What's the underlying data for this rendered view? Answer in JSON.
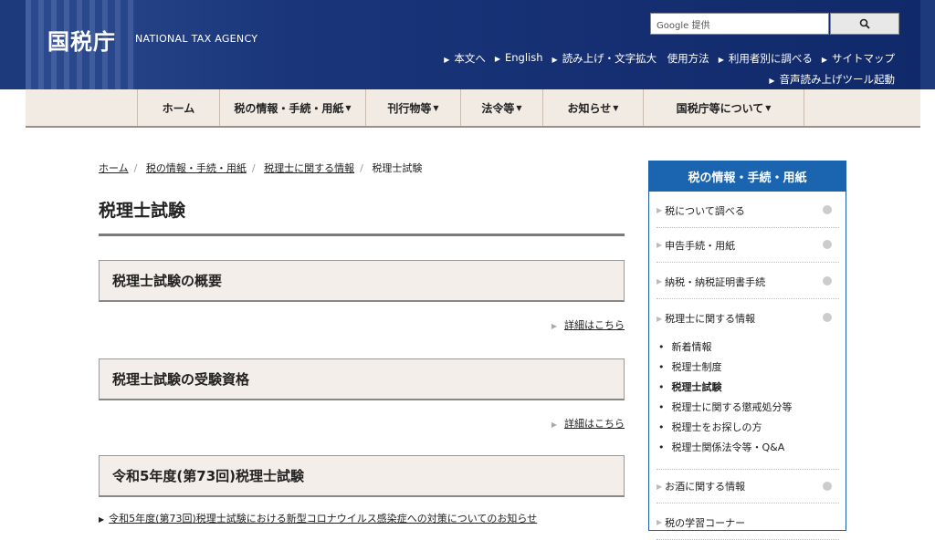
{
  "header": {
    "logo": "国税庁",
    "logo_en": "NATIONAL TAX AGENCY",
    "search_placeholder": "Google 提供",
    "util_links": [
      "本文へ",
      "English",
      "読み上げ・文字拡大　使用方法",
      "利用者別に調べる",
      "サイトマップ"
    ],
    "voice": "音声読み上げツール起動"
  },
  "gnav": [
    "ホーム",
    "税の情報・手続・用紙",
    "刊行物等",
    "法令等",
    "お知らせ",
    "国税庁等について"
  ],
  "breadcrumb": [
    "ホーム",
    "税の情報・手続・用紙",
    "税理士に関する情報",
    "税理士試験"
  ],
  "page_title": "税理士試験",
  "sections": [
    {
      "title": "税理士試験の概要",
      "more": "詳細はこちら"
    },
    {
      "title": "税理士試験の受験資格",
      "more": "詳細はこちら"
    },
    {
      "title": "令和5年度(第73回)税理士試験"
    }
  ],
  "notice": "令和5年度(第73回)税理士試験における新型コロナウイルス感染症への対策についてのお知らせ",
  "sidebar": {
    "title": "税の情報・手続・用紙",
    "items": [
      "税について調べる",
      "申告手続・用紙",
      "納税・納税証明書手続",
      "税理士に関する情報",
      "お酒に関する情報",
      "税の学習コーナー"
    ],
    "subitems": [
      "新着情報",
      "税理士制度",
      "税理士試験",
      "税理士に関する懲戒処分等",
      "税理士をお探しの方",
      "税理士関係法令等・Q&A"
    ]
  }
}
